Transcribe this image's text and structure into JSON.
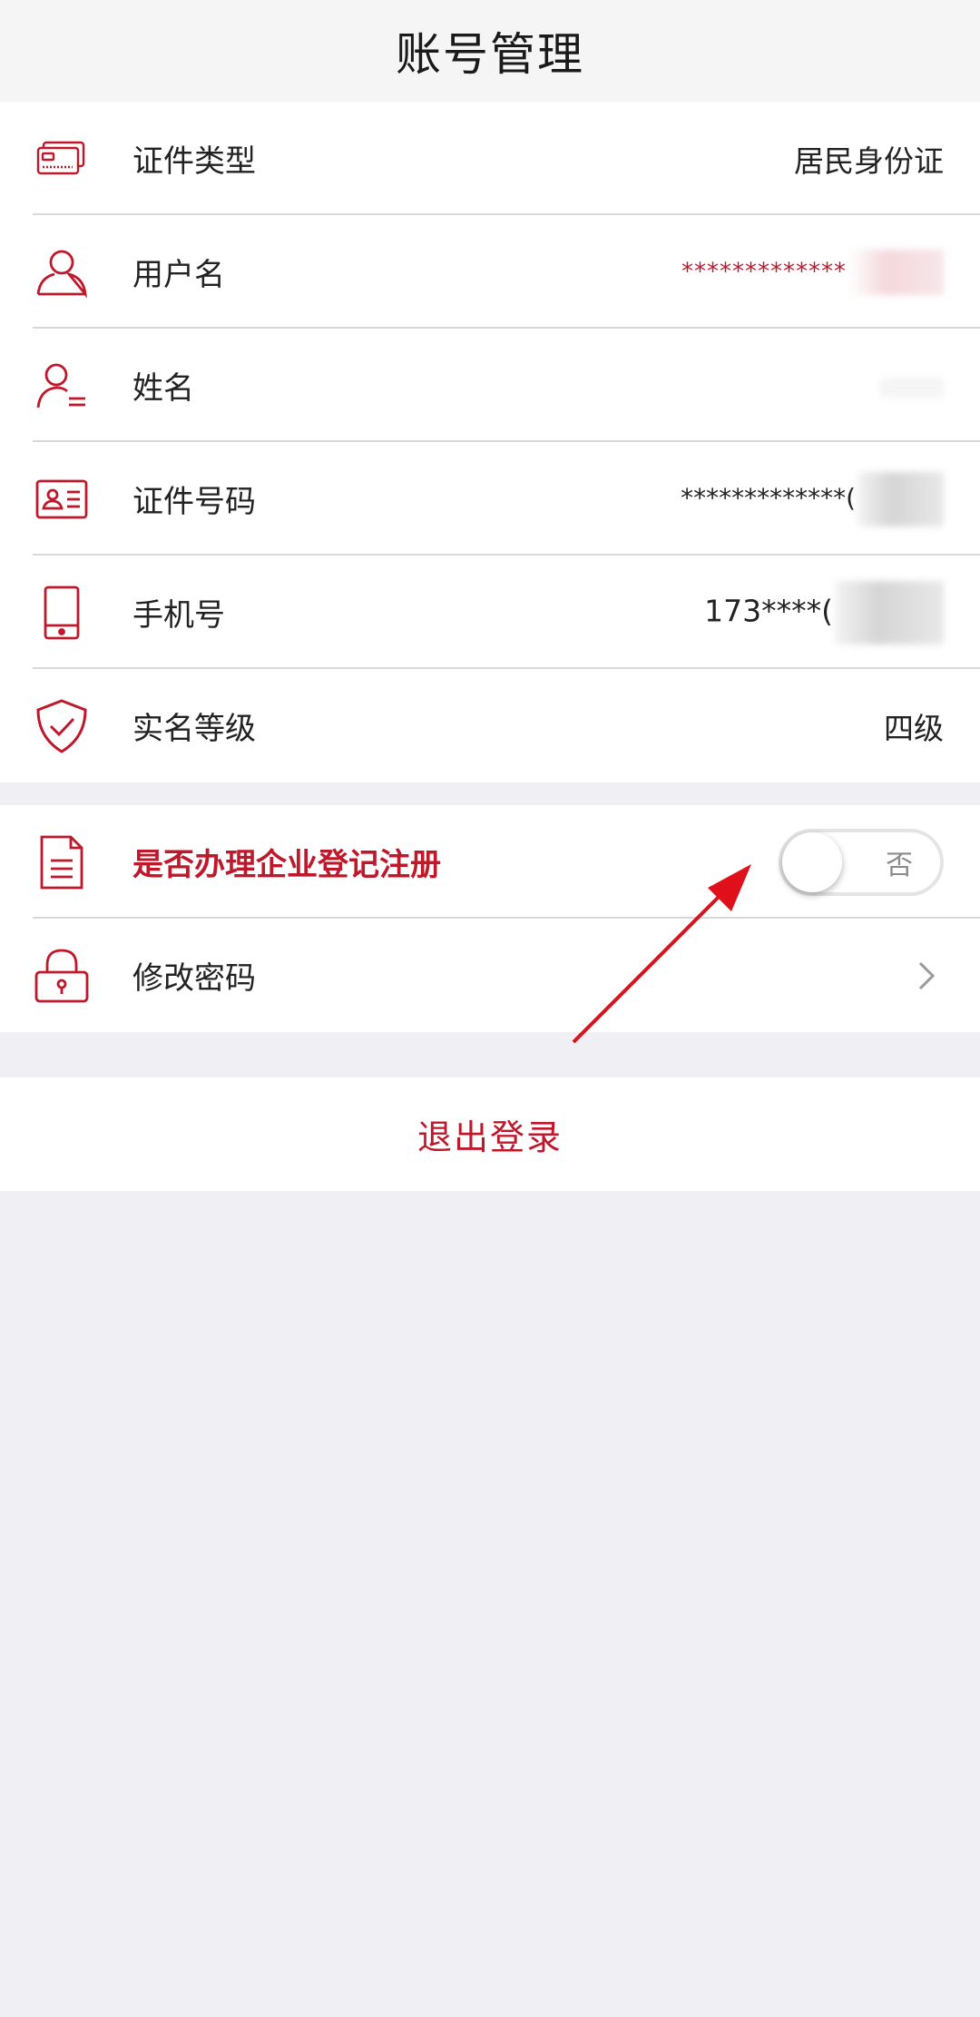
{
  "header": {
    "title": "账号管理"
  },
  "colors": {
    "accent": "#c0182b",
    "background": "#efeff4"
  },
  "account_rows": [
    {
      "icon": "id-cards-icon",
      "label": "证件类型",
      "value": "居民身份证"
    },
    {
      "icon": "user-icon",
      "label": "用户名",
      "value": "*************"
    },
    {
      "icon": "user-list-icon",
      "label": "姓名",
      "value": ""
    },
    {
      "icon": "id-card-icon",
      "label": "证件号码",
      "value": "*************("
    },
    {
      "icon": "mobile-phone-icon",
      "label": "手机号",
      "value": "173****("
    },
    {
      "icon": "shield-check-icon",
      "label": "实名等级",
      "value": "四级"
    }
  ],
  "settings_rows": {
    "enterprise": {
      "icon": "document-icon",
      "label": "是否办理企业登记注册",
      "toggle_text": "否",
      "toggle_on": false
    },
    "password": {
      "icon": "lock-icon",
      "label": "修改密码"
    }
  },
  "logout": {
    "label": "退出登录"
  }
}
